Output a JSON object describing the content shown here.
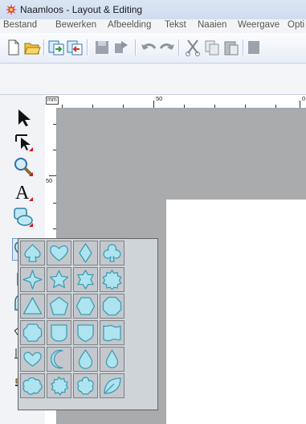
{
  "window": {
    "title": "Naamloos - Layout & Editing"
  },
  "menu": {
    "items": [
      "Bestand",
      "Bewerken",
      "Afbeelding",
      "Tekst",
      "Naaien",
      "Weergave",
      "Opti"
    ]
  },
  "toolbar": {
    "buttons": [
      "new-icon",
      "open-icon",
      "import-icon",
      "export-icon",
      "save-icon",
      "send-icon",
      "undo-icon",
      "redo-icon",
      "cut-icon",
      "copy-icon",
      "paste-icon",
      "more-icon"
    ]
  },
  "ruler": {
    "unit": "mm",
    "h_labels": [
      "50",
      "0"
    ],
    "v_labels": [
      "50"
    ]
  },
  "tools": [
    "select-arrow-icon",
    "point-edit-icon",
    "zoom-icon",
    "text-icon",
    "shape-icon",
    "stamp-shapes-icon",
    "hand-icon",
    "ribbon-icon",
    "measure-icon",
    "stitch-pattern-icon",
    "stamp-icon"
  ],
  "shape_palette": {
    "rows": [
      [
        "spade",
        "heart",
        "diamond",
        "club"
      ],
      [
        "star4",
        "star5",
        "star6",
        "burst"
      ],
      [
        "triangle",
        "pentagon",
        "hexagon",
        "octagon"
      ],
      [
        "cross-rounded",
        "shield-u",
        "shield",
        "wave-rect"
      ],
      [
        "heart-wide",
        "crescent",
        "drop",
        "teardrop"
      ],
      [
        "cloud",
        "seal",
        "flower",
        "leaf"
      ]
    ],
    "fill": "#aee4ef",
    "stroke": "#3f9bb4"
  },
  "colors": {
    "canvas": "#a9abad",
    "accent_red": "#d11111"
  }
}
